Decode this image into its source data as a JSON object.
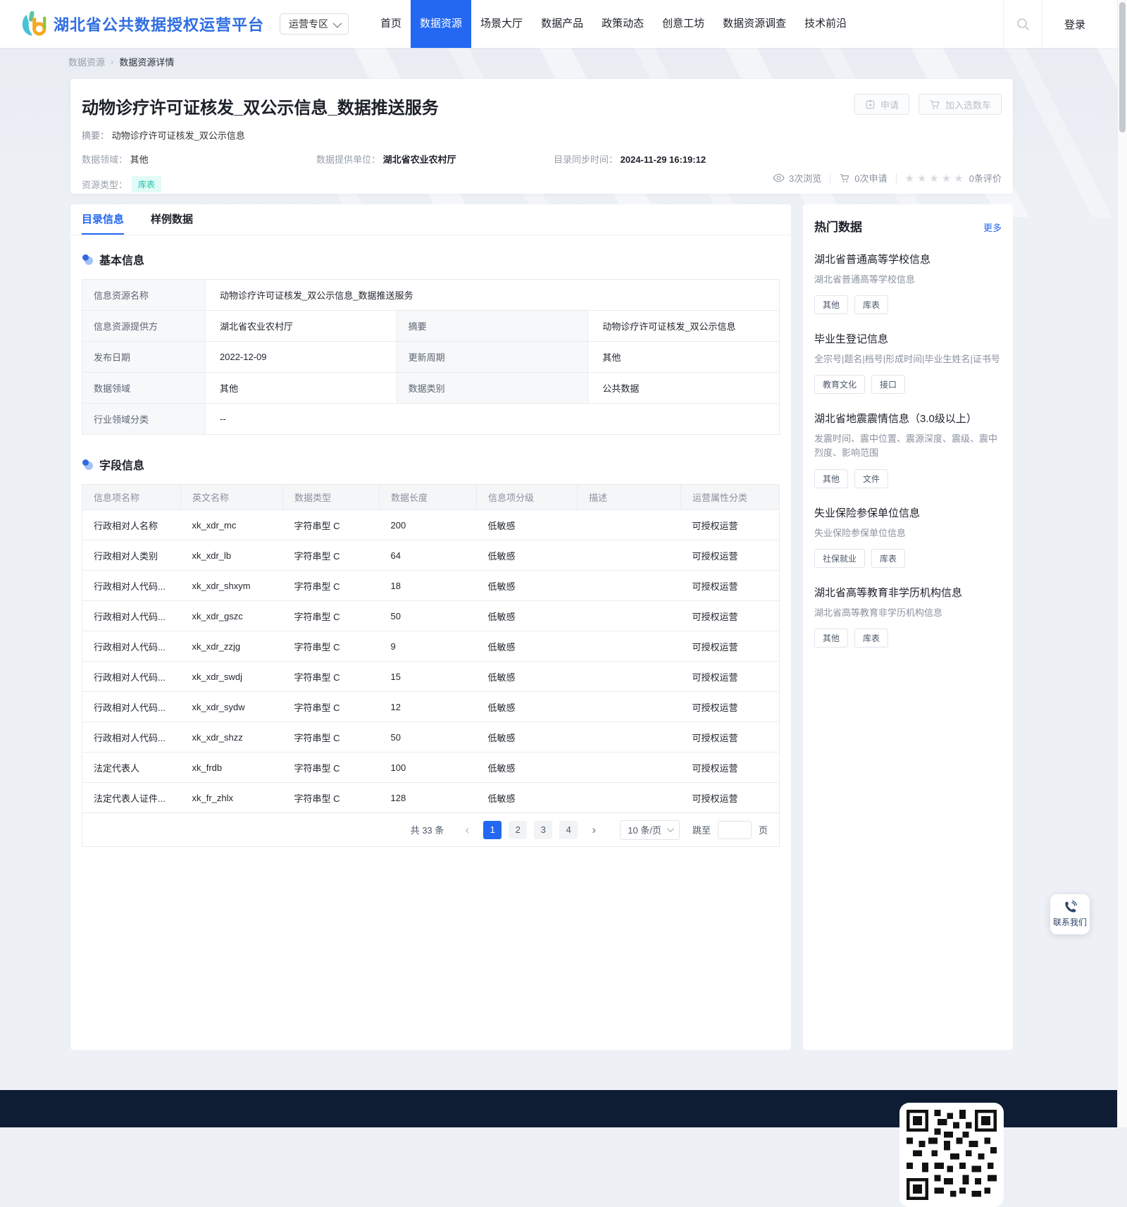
{
  "brand": {
    "name": "湖北省公共数据授权运营平台",
    "zone_select": "运营专区"
  },
  "nav": {
    "items": [
      "首页",
      "数据资源",
      "场景大厅",
      "数据产品",
      "政策动态",
      "创意工坊",
      "数据资源调查",
      "技术前沿"
    ],
    "active_index": 1,
    "login": "登录"
  },
  "breadcrumb": {
    "items": [
      "数据资源",
      "数据资源详情"
    ],
    "separator": "›"
  },
  "resource": {
    "title": "动物诊疗许可证核发_双公示信息_数据推送服务",
    "abstract_label": "摘要：",
    "abstract_value": "动物诊疗许可证核发_双公示信息",
    "meta": [
      {
        "label": "数据领域：",
        "value": "其他",
        "bold": false
      },
      {
        "label": "数据提供单位：",
        "value": "湖北省农业农村厅",
        "bold": true
      },
      {
        "label": "目录同步时间：",
        "value": "2024-11-29 16:19:12",
        "bold": true
      }
    ],
    "type_label": "资源类型：",
    "type_badge": "库表",
    "apply_button": "申请",
    "cart_button": "加入选数车",
    "stats": {
      "views": "3次浏览",
      "applies": "0次申请",
      "stars": "★★★★★",
      "reviews": "0条评价"
    }
  },
  "tabs": {
    "catalog": "目录信息",
    "sample": "样例数据"
  },
  "basic_info": {
    "section_title": "基本信息",
    "rows": {
      "r1_label": "信息资源名称",
      "r1_value": "动物诊疗许可证核发_双公示信息_数据推送服务",
      "r2_label1": "信息资源提供方",
      "r2_value1": "湖北省农业农村厅",
      "r2_label2": "摘要",
      "r2_value2": "动物诊疗许可证核发_双公示信息",
      "r3_label1": "发布日期",
      "r3_value1": "2022-12-09",
      "r3_label2": "更新周期",
      "r3_value2": "其他",
      "r4_label1": "数据领域",
      "r4_value1": "其他",
      "r4_label2": "数据类别",
      "r4_value2": "公共数据",
      "r5_label": "行业领域分类",
      "r5_value": "--"
    }
  },
  "field_info": {
    "section_title": "字段信息",
    "headers": [
      "信息项名称",
      "英文名称",
      "数据类型",
      "数据长度",
      "信息项分级",
      "描述",
      "运营属性分类"
    ],
    "rows": [
      [
        "行政相对人名称",
        "xk_xdr_mc",
        "字符串型 C",
        "200",
        "低敏感",
        "",
        "可授权运营"
      ],
      [
        "行政相对人类别",
        "xk_xdr_lb",
        "字符串型 C",
        "64",
        "低敏感",
        "",
        "可授权运营"
      ],
      [
        "行政相对人代码...",
        "xk_xdr_shxym",
        "字符串型 C",
        "18",
        "低敏感",
        "",
        "可授权运营"
      ],
      [
        "行政相对人代码...",
        "xk_xdr_gszc",
        "字符串型 C",
        "50",
        "低敏感",
        "",
        "可授权运营"
      ],
      [
        "行政相对人代码...",
        "xk_xdr_zzjg",
        "字符串型 C",
        "9",
        "低敏感",
        "",
        "可授权运营"
      ],
      [
        "行政相对人代码...",
        "xk_xdr_swdj",
        "字符串型 C",
        "15",
        "低敏感",
        "",
        "可授权运营"
      ],
      [
        "行政相对人代码...",
        "xk_xdr_sydw",
        "字符串型 C",
        "12",
        "低敏感",
        "",
        "可授权运营"
      ],
      [
        "行政相对人代码...",
        "xk_xdr_shzz",
        "字符串型 C",
        "50",
        "低敏感",
        "",
        "可授权运营"
      ],
      [
        "法定代表人",
        "xk_frdb",
        "字符串型 C",
        "100",
        "低敏感",
        "",
        "可授权运营"
      ],
      [
        "法定代表人证件...",
        "xk_fr_zhlx",
        "字符串型 C",
        "128",
        "低敏感",
        "",
        "可授权运营"
      ]
    ]
  },
  "pagination": {
    "total": "共 33 条",
    "pages": [
      "1",
      "2",
      "3",
      "4"
    ],
    "active_page": "1",
    "page_size": "10 条/页",
    "jump_label": "跳至",
    "page_unit": "页"
  },
  "hot_data": {
    "title": "热门数据",
    "more": "更多",
    "items": [
      {
        "title": "湖北省普通高等学校信息",
        "desc": "湖北省普通高等学校信息",
        "tags": [
          "其他",
          "库表"
        ]
      },
      {
        "title": "毕业生登记信息",
        "desc": "全宗号|题名|档号|形成时间|毕业生姓名|证书号",
        "tags": [
          "教育文化",
          "接口"
        ]
      },
      {
        "title": "湖北省地震震情信息（3.0级以上）",
        "desc": "发震时间、震中位置、震源深度、震级、震中烈度、影响范围",
        "tags": [
          "其他",
          "文件"
        ]
      },
      {
        "title": "失业保险参保单位信息",
        "desc": "失业保险参保单位信息",
        "tags": [
          "社保就业",
          "库表"
        ]
      },
      {
        "title": "湖北省高等教育非学历机构信息",
        "desc": "湖北省高等教育非学历机构信息",
        "tags": [
          "其他",
          "库表"
        ]
      }
    ]
  },
  "contact": {
    "label": "联系我们"
  },
  "colors": {
    "primary": "#2468f2",
    "brand_text": "#2f6de4",
    "badge_teal_bg": "#e1fbf6",
    "badge_teal_text": "#1cc4b0",
    "footer_bg": "#0e1c34"
  }
}
